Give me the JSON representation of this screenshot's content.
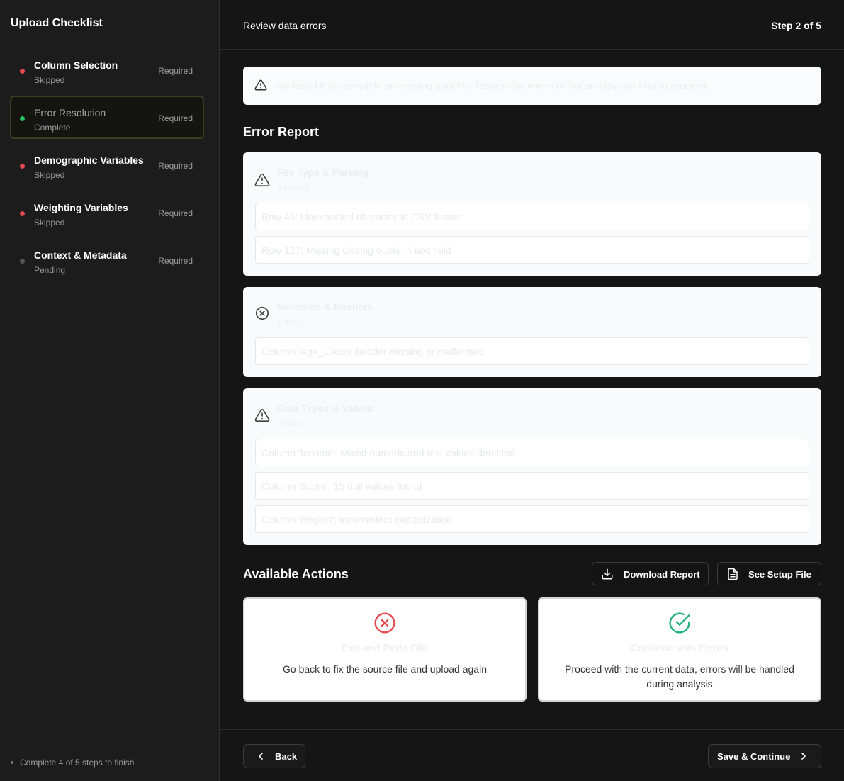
{
  "sidebar": {
    "title": "Upload Checklist",
    "steps": [
      {
        "name": "Column Selection",
        "status": "Skipped",
        "tag": "Required",
        "dot": "#e5484d"
      },
      {
        "name": "Error Resolution",
        "status": "Complete",
        "tag": "Required",
        "dot": "#22c55e"
      },
      {
        "name": "Demographic Variables",
        "status": "Skipped",
        "tag": "Required",
        "dot": "#e5484d"
      },
      {
        "name": "Weighting Variables",
        "status": "Skipped",
        "tag": "Required",
        "dot": "#e5484d"
      },
      {
        "name": "Context & Metadata",
        "status": "Pending",
        "tag": "Required",
        "dot": "#555555"
      }
    ],
    "footer": "Complete 4 of 5 steps to finish"
  },
  "header": {
    "title": "Review data errors",
    "step_count": "Step 2 of 5"
  },
  "alert": {
    "icon": "warning-icon",
    "text": "We found 6 issues while processing your file. Review the errors below and choose how to proceed."
  },
  "report": {
    "title": "Error Report",
    "groups": [
      {
        "icon": "warning-icon",
        "title": "File Type & Parsing",
        "count": "2 issues",
        "rows": [
          "Row 45: Unexpected character in CSV format",
          "Row 127: Missing closing quote in text field"
        ]
      },
      {
        "icon": "x-circle-icon",
        "title": "Selection & Headers",
        "count": "1 issue",
        "rows": [
          "Column 'Age_Group' header missing or malformed"
        ]
      },
      {
        "icon": "warning-icon",
        "title": "Data Types & Values",
        "count": "3 issues",
        "rows": [
          "Column 'Income': Mixed numeric and text values detected",
          "Column 'Score': 15 null values found",
          "Column 'Region': Inconsistent capitalization"
        ]
      }
    ]
  },
  "actions": {
    "title": "Available Actions",
    "download_label": "Download Report",
    "setup_label": "See Setup File",
    "exit": {
      "title": "Exit and Redo File",
      "desc": "Go back to fix the source file and upload again",
      "color": "#e5484d"
    },
    "continue": {
      "title": "Continue with Errors",
      "desc": "Proceed with the current data, errors will be handled during analysis",
      "color": "#22b07d"
    }
  },
  "footer": {
    "back_label": "Back",
    "next_label": "Save & Continue"
  }
}
